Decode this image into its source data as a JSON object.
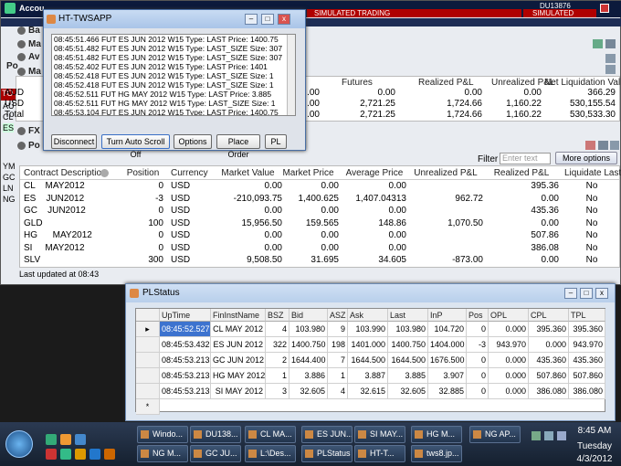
{
  "tws": {
    "title": "Accou",
    "account_id": "DU13876",
    "sim_label": "SIMULATED TRADING",
    "sections": [
      "Ba",
      "Ma",
      "Av",
      "Ma",
      "FX",
      "Po"
    ],
    "tab_po": "Po",
    "summary": {
      "headers": [
        "Futures",
        "Realized P&L",
        "Unrealized P&L",
        "Net Liquidation Val..."
      ],
      "rows": [
        {
          "label": "AUD",
          "c0": ".00",
          "c1": "0.00",
          "c2": "0.00",
          "c3": "0.00",
          "c4": "366.29"
        },
        {
          "label": "USD",
          "c0": ".00",
          "c1": "2,721.25",
          "c2": "1,724.66",
          "c3": "1,160.22",
          "c4": "530,155.54"
        },
        {
          "label": "Total",
          "c0": ".00",
          "c1": "2,721.25",
          "c2": "1,724.66",
          "c3": "1,160.22",
          "c4": "530,533.30"
        }
      ]
    },
    "side_labels": [
      "TO",
      "AU",
      "CL",
      "ES",
      "YM",
      "GC",
      "LN",
      "NG"
    ],
    "filter_label": "Filter",
    "filter_placeholder": "Enter text",
    "more_options": "More options",
    "positions": {
      "headers": [
        "Contract Description",
        "Position",
        "Currency",
        "Market Value",
        "Market Price",
        "Average Price",
        "Unrealized P&L",
        "Realized P&L",
        "Liquidate Last"
      ],
      "rows": [
        [
          "CL    MAY2012",
          "0",
          "USD",
          "0.00",
          "0.00",
          "0.00",
          "",
          "395.36",
          "No"
        ],
        [
          "ES    JUN2012",
          "-3",
          "USD",
          "-210,093.75",
          "1,400.625",
          "1,407.04313",
          "962.72",
          "0.00",
          "No"
        ],
        [
          "GC    JUN2012",
          "0",
          "USD",
          "0.00",
          "0.00",
          "0.00",
          "",
          "435.36",
          "No"
        ],
        [
          "GLD",
          "100",
          "USD",
          "15,956.50",
          "159.565",
          "148.86",
          "1,070.50",
          "0.00",
          "No"
        ],
        [
          "HG      MAY2012",
          "0",
          "USD",
          "0.00",
          "0.00",
          "0.00",
          "",
          "507.86",
          "No"
        ],
        [
          "SI     MAY2012",
          "0",
          "USD",
          "0.00",
          "0.00",
          "0.00",
          "",
          "386.08",
          "No"
        ],
        [
          "SLV",
          "300",
          "USD",
          "9,508.50",
          "31.695",
          "34.605",
          "-873.00",
          "0.00",
          "No"
        ]
      ]
    },
    "last_updated": "Last updated at 08:43"
  },
  "popup": {
    "title": "HT-TWSAPP",
    "log": [
      "08:45:51.466 FUT ES JUN 2012 W15 Type: LAST Price: 1400.75",
      "08:45:51.482 FUT ES JUN 2012 W15 Type: LAST_SIZE Size: 307",
      "08:45:51.482 FUT ES JUN 2012 W15 Type: LAST_SIZE Size: 307",
      "08:45:52.402 FUT ES JUN 2012 W15 Type: LAST Price: 1401",
      "08:45:52.418 FUT ES JUN 2012 W15 Type: LAST_SIZE Size: 1",
      "08:45:52.418 FUT ES JUN 2012 W15 Type: LAST_SIZE Size: 1",
      "08:45:52.511 FUT HG MAY 2012 W15 Type: LAST Price: 3.885",
      "08:45:52.511 FUT HG MAY 2012 W15 Type: LAST_SIZE Size: 1",
      "08:45:53.104 FUT ES JUN 2012 W15 Type: LAST Price: 1400.75",
      "08:45:53.104 FUT ES JUN 2012 W15 Type: LAST_SIZE Size: 1"
    ],
    "buttons": [
      "Disconnect",
      "Turn Auto Scroll Off",
      "Options",
      "Place Order",
      "PL"
    ]
  },
  "plstatus": {
    "title": "PLStatus",
    "headers": [
      "UpTime",
      "FinInstName",
      "BSZ",
      "Bid",
      "ASZ",
      "Ask",
      "Last",
      "InP",
      "Pos",
      "OPL",
      "CPL",
      "TPL"
    ],
    "rows": [
      [
        "08:45:52.527",
        "CL MAY 2012",
        "4",
        "103.980",
        "9",
        "103.990",
        "103.980",
        "104.720",
        "0",
        "0.000",
        "395.360",
        "395.360"
      ],
      [
        "08:45:53.432",
        "ES JUN 2012",
        "322",
        "1400.750",
        "198",
        "1401.000",
        "1400.750",
        "1404.000",
        "-3",
        "943.970",
        "0.000",
        "943.970"
      ],
      [
        "08:45:53.213",
        "GC JUN 2012",
        "2",
        "1644.400",
        "7",
        "1644.500",
        "1644.500",
        "1676.500",
        "0",
        "0.000",
        "435.360",
        "435.360"
      ],
      [
        "08:45:53.213",
        "HG MAY 2012",
        "1",
        "3.886",
        "1",
        "3.887",
        "3.885",
        "3.907",
        "0",
        "0.000",
        "507.860",
        "507.860"
      ],
      [
        "08:45:53.213",
        "SI MAY 2012",
        "3",
        "32.605",
        "4",
        "32.615",
        "32.605",
        "32.885",
        "0",
        "0.000",
        "386.080",
        "386.080"
      ]
    ],
    "new_row_marker": "*",
    "current_row_marker": "▸"
  },
  "taskbar": {
    "row1": [
      "Windo...",
      "DU138...",
      "CL MA...",
      "ES JUN...",
      "SI MAY...",
      "HG M...",
      "NG AP..."
    ],
    "row2": [
      "NG M...",
      "GC JU...",
      "L:\\Des...",
      "PLStatus",
      "HT-T...",
      "tws8.jp..."
    ],
    "time": "8:45 AM",
    "day": "Tuesday",
    "date": "4/3/2012"
  }
}
